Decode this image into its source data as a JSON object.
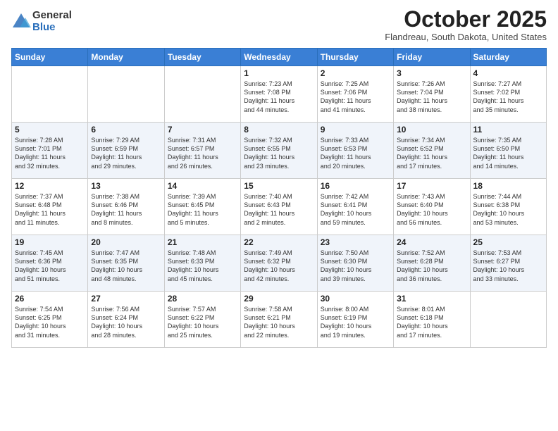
{
  "header": {
    "logo_general": "General",
    "logo_blue": "Blue",
    "month_title": "October 2025",
    "location": "Flandreau, South Dakota, United States"
  },
  "weekdays": [
    "Sunday",
    "Monday",
    "Tuesday",
    "Wednesday",
    "Thursday",
    "Friday",
    "Saturday"
  ],
  "weeks": [
    [
      {
        "day": "",
        "info": ""
      },
      {
        "day": "",
        "info": ""
      },
      {
        "day": "",
        "info": ""
      },
      {
        "day": "1",
        "info": "Sunrise: 7:23 AM\nSunset: 7:08 PM\nDaylight: 11 hours\nand 44 minutes."
      },
      {
        "day": "2",
        "info": "Sunrise: 7:25 AM\nSunset: 7:06 PM\nDaylight: 11 hours\nand 41 minutes."
      },
      {
        "day": "3",
        "info": "Sunrise: 7:26 AM\nSunset: 7:04 PM\nDaylight: 11 hours\nand 38 minutes."
      },
      {
        "day": "4",
        "info": "Sunrise: 7:27 AM\nSunset: 7:02 PM\nDaylight: 11 hours\nand 35 minutes."
      }
    ],
    [
      {
        "day": "5",
        "info": "Sunrise: 7:28 AM\nSunset: 7:01 PM\nDaylight: 11 hours\nand 32 minutes."
      },
      {
        "day": "6",
        "info": "Sunrise: 7:29 AM\nSunset: 6:59 PM\nDaylight: 11 hours\nand 29 minutes."
      },
      {
        "day": "7",
        "info": "Sunrise: 7:31 AM\nSunset: 6:57 PM\nDaylight: 11 hours\nand 26 minutes."
      },
      {
        "day": "8",
        "info": "Sunrise: 7:32 AM\nSunset: 6:55 PM\nDaylight: 11 hours\nand 23 minutes."
      },
      {
        "day": "9",
        "info": "Sunrise: 7:33 AM\nSunset: 6:53 PM\nDaylight: 11 hours\nand 20 minutes."
      },
      {
        "day": "10",
        "info": "Sunrise: 7:34 AM\nSunset: 6:52 PM\nDaylight: 11 hours\nand 17 minutes."
      },
      {
        "day": "11",
        "info": "Sunrise: 7:35 AM\nSunset: 6:50 PM\nDaylight: 11 hours\nand 14 minutes."
      }
    ],
    [
      {
        "day": "12",
        "info": "Sunrise: 7:37 AM\nSunset: 6:48 PM\nDaylight: 11 hours\nand 11 minutes."
      },
      {
        "day": "13",
        "info": "Sunrise: 7:38 AM\nSunset: 6:46 PM\nDaylight: 11 hours\nand 8 minutes."
      },
      {
        "day": "14",
        "info": "Sunrise: 7:39 AM\nSunset: 6:45 PM\nDaylight: 11 hours\nand 5 minutes."
      },
      {
        "day": "15",
        "info": "Sunrise: 7:40 AM\nSunset: 6:43 PM\nDaylight: 11 hours\nand 2 minutes."
      },
      {
        "day": "16",
        "info": "Sunrise: 7:42 AM\nSunset: 6:41 PM\nDaylight: 10 hours\nand 59 minutes."
      },
      {
        "day": "17",
        "info": "Sunrise: 7:43 AM\nSunset: 6:40 PM\nDaylight: 10 hours\nand 56 minutes."
      },
      {
        "day": "18",
        "info": "Sunrise: 7:44 AM\nSunset: 6:38 PM\nDaylight: 10 hours\nand 53 minutes."
      }
    ],
    [
      {
        "day": "19",
        "info": "Sunrise: 7:45 AM\nSunset: 6:36 PM\nDaylight: 10 hours\nand 51 minutes."
      },
      {
        "day": "20",
        "info": "Sunrise: 7:47 AM\nSunset: 6:35 PM\nDaylight: 10 hours\nand 48 minutes."
      },
      {
        "day": "21",
        "info": "Sunrise: 7:48 AM\nSunset: 6:33 PM\nDaylight: 10 hours\nand 45 minutes."
      },
      {
        "day": "22",
        "info": "Sunrise: 7:49 AM\nSunset: 6:32 PM\nDaylight: 10 hours\nand 42 minutes."
      },
      {
        "day": "23",
        "info": "Sunrise: 7:50 AM\nSunset: 6:30 PM\nDaylight: 10 hours\nand 39 minutes."
      },
      {
        "day": "24",
        "info": "Sunrise: 7:52 AM\nSunset: 6:28 PM\nDaylight: 10 hours\nand 36 minutes."
      },
      {
        "day": "25",
        "info": "Sunrise: 7:53 AM\nSunset: 6:27 PM\nDaylight: 10 hours\nand 33 minutes."
      }
    ],
    [
      {
        "day": "26",
        "info": "Sunrise: 7:54 AM\nSunset: 6:25 PM\nDaylight: 10 hours\nand 31 minutes."
      },
      {
        "day": "27",
        "info": "Sunrise: 7:56 AM\nSunset: 6:24 PM\nDaylight: 10 hours\nand 28 minutes."
      },
      {
        "day": "28",
        "info": "Sunrise: 7:57 AM\nSunset: 6:22 PM\nDaylight: 10 hours\nand 25 minutes."
      },
      {
        "day": "29",
        "info": "Sunrise: 7:58 AM\nSunset: 6:21 PM\nDaylight: 10 hours\nand 22 minutes."
      },
      {
        "day": "30",
        "info": "Sunrise: 8:00 AM\nSunset: 6:19 PM\nDaylight: 10 hours\nand 19 minutes."
      },
      {
        "day": "31",
        "info": "Sunrise: 8:01 AM\nSunset: 6:18 PM\nDaylight: 10 hours\nand 17 minutes."
      },
      {
        "day": "",
        "info": ""
      }
    ]
  ]
}
